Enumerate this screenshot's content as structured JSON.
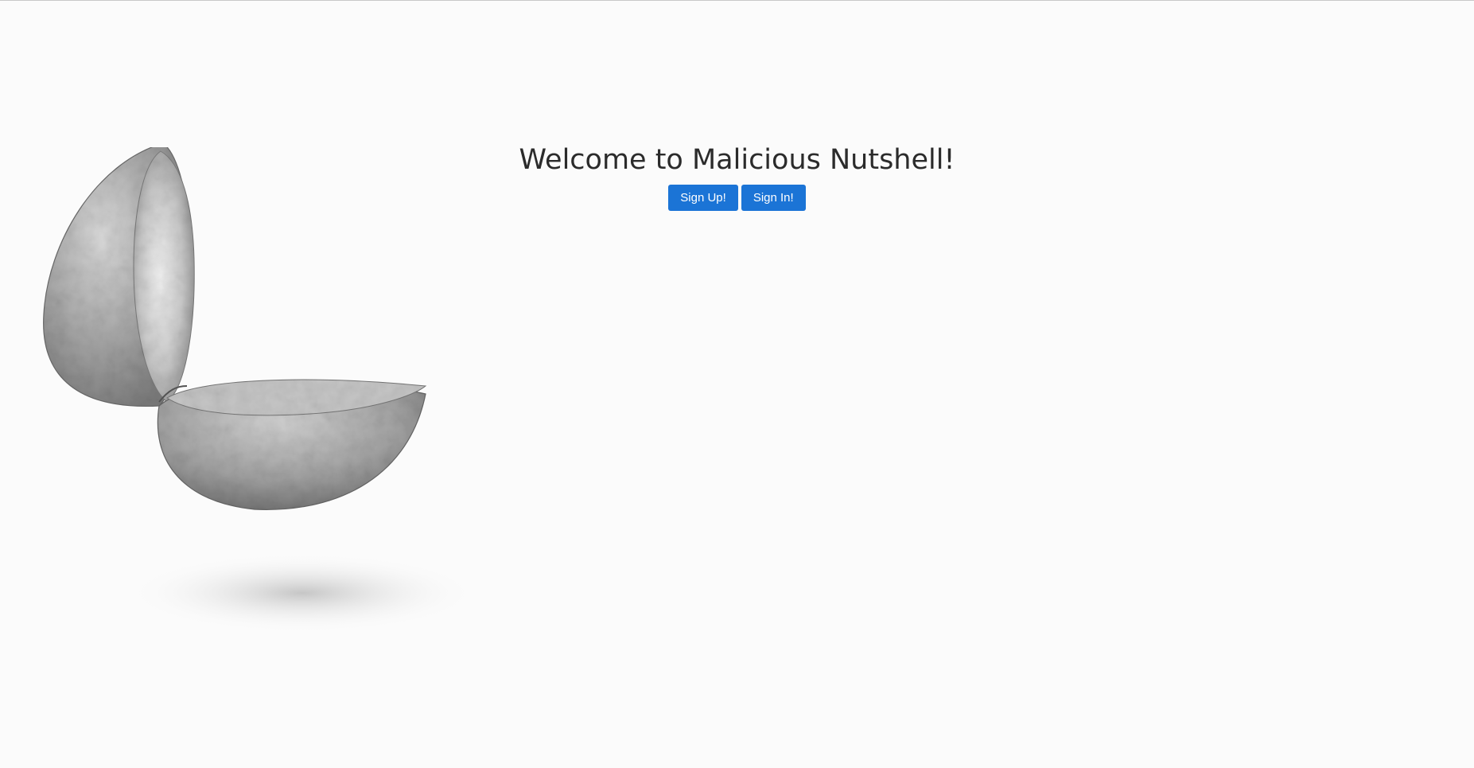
{
  "page": {
    "title": "Welcome to Malicious Nutshell!",
    "background": "#fbfbfb"
  },
  "actions": {
    "sign_up_label": "Sign Up!",
    "sign_in_label": "Sign In!",
    "button_color": "#1b74d6"
  },
  "hero": {
    "icon": "open-walnut-shell-image"
  }
}
